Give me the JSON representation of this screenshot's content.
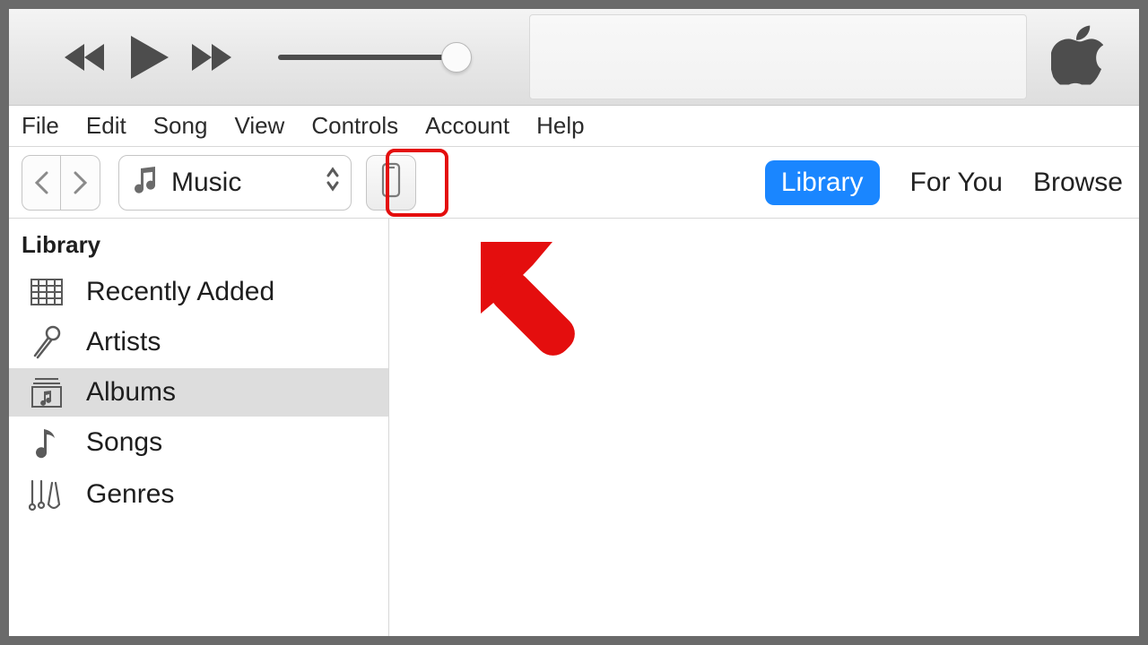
{
  "menubar": [
    "File",
    "Edit",
    "Song",
    "View",
    "Controls",
    "Account",
    "Help"
  ],
  "toolbar": {
    "media_label": "Music",
    "tabs": {
      "library": "Library",
      "for_you": "For You",
      "browse": "Browse"
    }
  },
  "sidebar": {
    "header": "Library",
    "items": [
      {
        "icon": "grid",
        "label": "Recently Added",
        "selected": false
      },
      {
        "icon": "mic",
        "label": "Artists",
        "selected": false
      },
      {
        "icon": "album",
        "label": "Albums",
        "selected": true
      },
      {
        "icon": "note",
        "label": "Songs",
        "selected": false
      },
      {
        "icon": "guitar",
        "label": "Genres",
        "selected": false
      }
    ]
  },
  "annotation": {
    "highlight_color": "#e40e0e",
    "arrow_color": "#e40e0e"
  }
}
